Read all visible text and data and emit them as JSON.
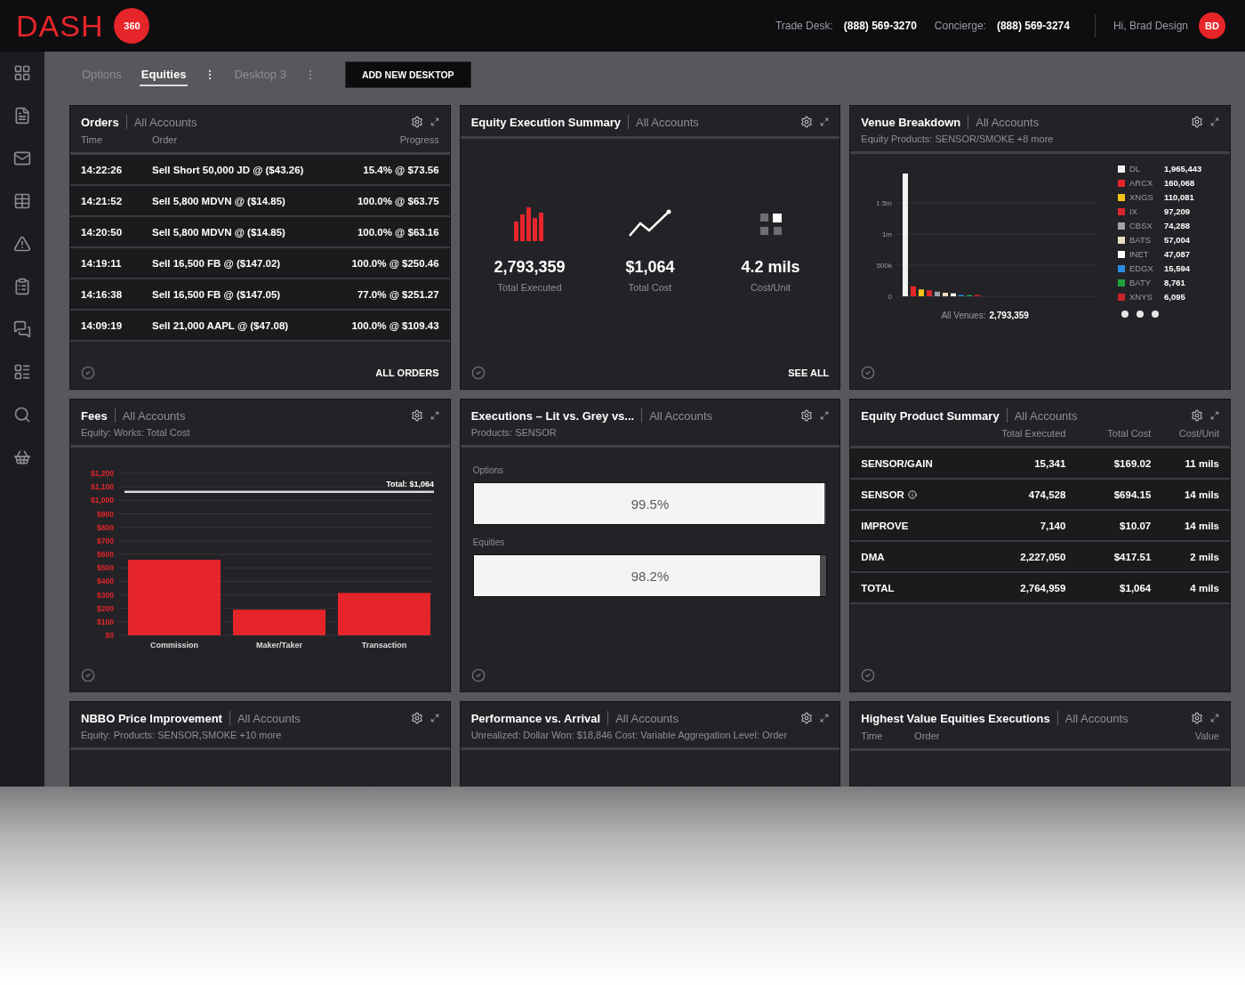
{
  "header": {
    "logo": "DASH",
    "logo_badge": "360",
    "contacts": [
      {
        "label": "Trade Desk:",
        "phone": "(888) 569-3270"
      },
      {
        "label": "Concierge:",
        "phone": "(888) 569-3274"
      }
    ],
    "greeting": "Hi, Brad Design",
    "avatar_initials": "BD"
  },
  "tabs": [
    {
      "label": "Options",
      "selected": false
    },
    {
      "label": "Equities",
      "selected": true
    },
    {
      "label": "Desktop 3",
      "selected": false
    }
  ],
  "add_desktop_button": "ADD NEW DESKTOP",
  "panels": [
    {
      "kind": "orders",
      "title": "Orders",
      "scope": "All Accounts",
      "columns": [
        "Time",
        "Order",
        "Progress"
      ],
      "rows": [
        {
          "time": "14:22:26",
          "order": "Sell Short 50,000 JD @ ($43.26)",
          "progress": "15.4% @ $73.56"
        },
        {
          "time": "14:21:52",
          "order": "Sell 5,800 MDVN @ ($14.85)",
          "progress": "100.0% @ $63.75"
        },
        {
          "time": "14:20:50",
          "order": "Sell 5,800 MDVN @ ($14.85)",
          "progress": "100.0% @ $63.16"
        },
        {
          "time": "14:19:11",
          "order": "Sell 16,500 FB @ ($147.02)",
          "progress": "100.0% @ $250.46"
        },
        {
          "time": "14:16:38",
          "order": "Sell 16,500 FB @ ($147.05)",
          "progress": "77.0% @ $251.27"
        },
        {
          "time": "14:09:19",
          "order": "Sell 21,000 AAPL @ ($47.08)",
          "progress": "100.0% @ $109.43"
        }
      ],
      "footer_link": "ALL ORDERS"
    },
    {
      "kind": "summary",
      "title": "Equity Execution Summary",
      "scope": "All Accounts",
      "stats": [
        {
          "value": "2,793,359",
          "label": "Total Executed"
        },
        {
          "value": "$1,064",
          "label": "Total Cost"
        },
        {
          "value": "4.2 mils",
          "label": "Cost/Unit"
        }
      ],
      "footer_link": "SEE ALL"
    },
    {
      "kind": "venue",
      "title": "Venue Breakdown",
      "scope": "All Accounts",
      "subtitle": "Equity Products: SENSOR/SMOKE +8 more",
      "axis_labels": [
        "1.5m",
        "1m",
        "500k",
        "0"
      ],
      "legend": [
        {
          "name": "DL",
          "value": "1,965,443",
          "color": "#f2f2f2"
        },
        {
          "name": "ARCX",
          "value": "160,068",
          "color": "#e5252a"
        },
        {
          "name": "XNGS",
          "value": "110,081",
          "color": "#f2c417"
        },
        {
          "name": "IX",
          "value": "97,209",
          "color": "#d9262c"
        },
        {
          "name": "CBSX",
          "value": "74,288",
          "color": "#9ea3a8"
        },
        {
          "name": "BATS",
          "value": "57,004",
          "color": "#e8dcc0"
        },
        {
          "name": "INET",
          "value": "47,087",
          "color": "#ffffff"
        },
        {
          "name": "EDGX",
          "value": "15,594",
          "color": "#2a8be0"
        },
        {
          "name": "BATY",
          "value": "8,761",
          "color": "#23a03c"
        },
        {
          "name": "XNYS",
          "value": "6,095",
          "color": "#c8232a"
        }
      ],
      "total_label": "All Venues:",
      "total_value": "2,793,359"
    },
    {
      "kind": "fees",
      "title": "Fees",
      "scope": "All Accounts",
      "subtitle": "Equity: Works: Total Cost",
      "chart_data": {
        "type": "bar",
        "categories": [
          "Commission",
          "Maker/Taker",
          "Transaction"
        ],
        "series": [
          {
            "color": "#e5252a",
            "values": [
              560,
              190,
              314
            ]
          }
        ],
        "ylim": [
          0,
          1200
        ],
        "yticks": [
          {
            "value": 0,
            "label": "$0"
          },
          {
            "value": 100,
            "label": "$100"
          },
          {
            "value": 200,
            "label": "$200"
          },
          {
            "value": 300,
            "label": "$300"
          },
          {
            "value": 400,
            "label": "$400"
          },
          {
            "value": 500,
            "label": "$500"
          },
          {
            "value": 600,
            "label": "$600"
          },
          {
            "value": 700,
            "label": "$700"
          },
          {
            "value": 800,
            "label": "$800"
          },
          {
            "value": 900,
            "label": "$900"
          },
          {
            "value": 1000,
            "label": "$1,000"
          },
          {
            "value": 1100,
            "label": "$1,100"
          },
          {
            "value": 1200,
            "label": "$1,200"
          }
        ],
        "grid": true,
        "ref_lines": [
          {
            "axis": "y",
            "value": 1064,
            "label": "Total: $1,064"
          }
        ]
      }
    },
    {
      "kind": "executions",
      "title": "Executions – Lit vs. Grey vs...",
      "scope": "All Accounts",
      "subtitle": "Products: SENSOR",
      "bars": [
        {
          "label": "Options",
          "level": 0.995,
          "reading": "99.5%"
        },
        {
          "label": "Equities",
          "level": 0.982,
          "reading": "98.2%"
        }
      ]
    },
    {
      "kind": "product_summary",
      "title": "Equity Product Summary",
      "scope": "All Accounts",
      "columns": [
        "Total Executed",
        "Total Cost",
        "Cost/Unit"
      ],
      "rows": [
        {
          "name": "SENSOR/GAIN",
          "info": false,
          "cells": [
            "15,341",
            "$169.02",
            "11 mils"
          ]
        },
        {
          "name": "SENSOR",
          "info": true,
          "cells": [
            "474,528",
            "$694.15",
            "14 mils"
          ]
        },
        {
          "name": "IMPROVE",
          "info": false,
          "cells": [
            "7,140",
            "$10.07",
            "14 mils"
          ]
        },
        {
          "name": "DMA",
          "info": false,
          "cells": [
            "2,227,050",
            "$417.51",
            "2 mils"
          ]
        },
        {
          "name": "TOTAL",
          "info": false,
          "cells": [
            "2,764,959",
            "$1,064",
            "4 mils"
          ]
        }
      ]
    },
    {
      "kind": "heading",
      "title": "NBBO Price Improvement",
      "scope": "All Accounts",
      "subtitle": "Equity: Products: SENSOR,SMOKE +10 more"
    },
    {
      "kind": "heading",
      "title": "Performance vs. Arrival",
      "scope": "All Accounts",
      "subtitle": "Unrealized: Dollar Won: $18,846 Cost: Variable Aggregation Level: Order"
    },
    {
      "kind": "heading",
      "title": "Highest Value Equities Executions",
      "scope": "All Accounts",
      "columns": [
        "Time",
        "Order",
        "Value"
      ]
    }
  ]
}
